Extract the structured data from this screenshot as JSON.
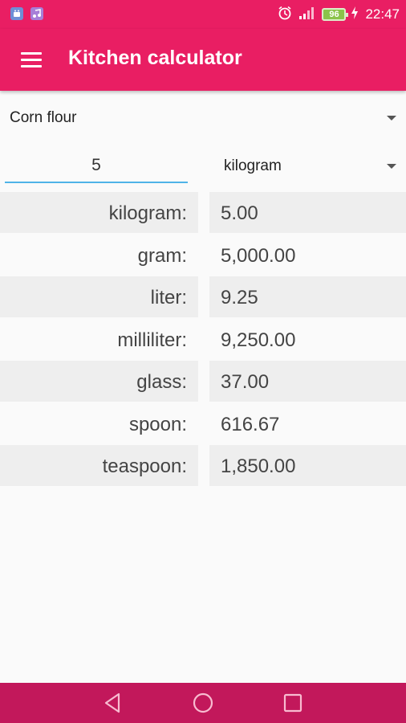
{
  "status_bar": {
    "time": "22:47",
    "battery": "96",
    "icons": [
      "android-notification-icon",
      "music-notification-icon",
      "alarm-icon",
      "signal-icon",
      "battery-icon",
      "charging-icon"
    ]
  },
  "app_bar": {
    "title": "Kitchen calculator",
    "menu_icon": "hamburger-menu-icon"
  },
  "product": {
    "selected": "Corn flour"
  },
  "amount": {
    "value": "5"
  },
  "unit": {
    "selected": "kilogram"
  },
  "results": [
    {
      "label": "kilogram:",
      "value": "5.00"
    },
    {
      "label": "gram:",
      "value": "5,000.00"
    },
    {
      "label": "liter:",
      "value": "9.25"
    },
    {
      "label": "milliliter:",
      "value": "9,250.00"
    },
    {
      "label": "glass:",
      "value": "37.00"
    },
    {
      "label": "spoon:",
      "value": "616.67"
    },
    {
      "label": "teaspoon:",
      "value": "1,850.00"
    }
  ],
  "nav_bar": {
    "icons": [
      "back-icon",
      "home-icon",
      "recents-icon"
    ]
  },
  "colors": {
    "primary": "#e91e63",
    "nav_bar": "#c2185b",
    "input_underline": "#4fb3e8",
    "row_shade": "#eeeeee"
  }
}
